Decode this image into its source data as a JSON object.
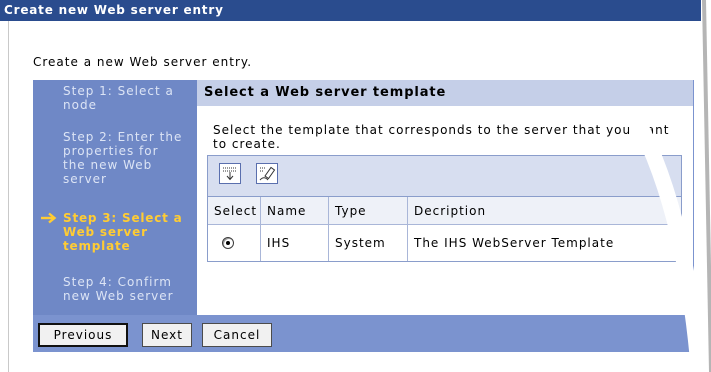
{
  "window": {
    "title": "Create new Web server entry"
  },
  "page": {
    "description": "Create a new Web server entry."
  },
  "wizard": {
    "current_step_icon": "arrow-right-icon",
    "steps": [
      {
        "label": "Step 1: Select a\nnode",
        "current": false
      },
      {
        "label": "Step 2: Enter the\nproperties for\nthe new Web\nserver",
        "current": false
      },
      {
        "label": "Step 3: Select a\nWeb server\ntemplate",
        "current": true
      },
      {
        "label": "Step 4: Confirm\nnew Web server",
        "current": false
      }
    ],
    "title": "Select a Web server template",
    "instructions": "Select the template that corresponds to the server that you want\nto create.",
    "table": {
      "toolbar": [
        {
          "icon": "select-all-icon"
        },
        {
          "icon": "deselect-all-icon"
        }
      ],
      "columns": [
        "Select",
        "Name",
        "Type",
        "Decription"
      ],
      "rows": [
        {
          "selected": true,
          "name": "IHS",
          "type": "System",
          "description": "The IHS WebServer Template"
        }
      ]
    },
    "buttons": {
      "previous": "Previous",
      "next": "Next",
      "cancel": "Cancel"
    }
  },
  "colors": {
    "title_bar": "#2A4C8E",
    "steps_panel": "#6F88C6",
    "step_text": "#DCE4F5",
    "current_step": "#FFCC33",
    "header_band": "#C5CFE8",
    "button_bar": "#7B93CF",
    "toolbar": "#D7DEF0",
    "table_border": "#8A9DCB"
  }
}
